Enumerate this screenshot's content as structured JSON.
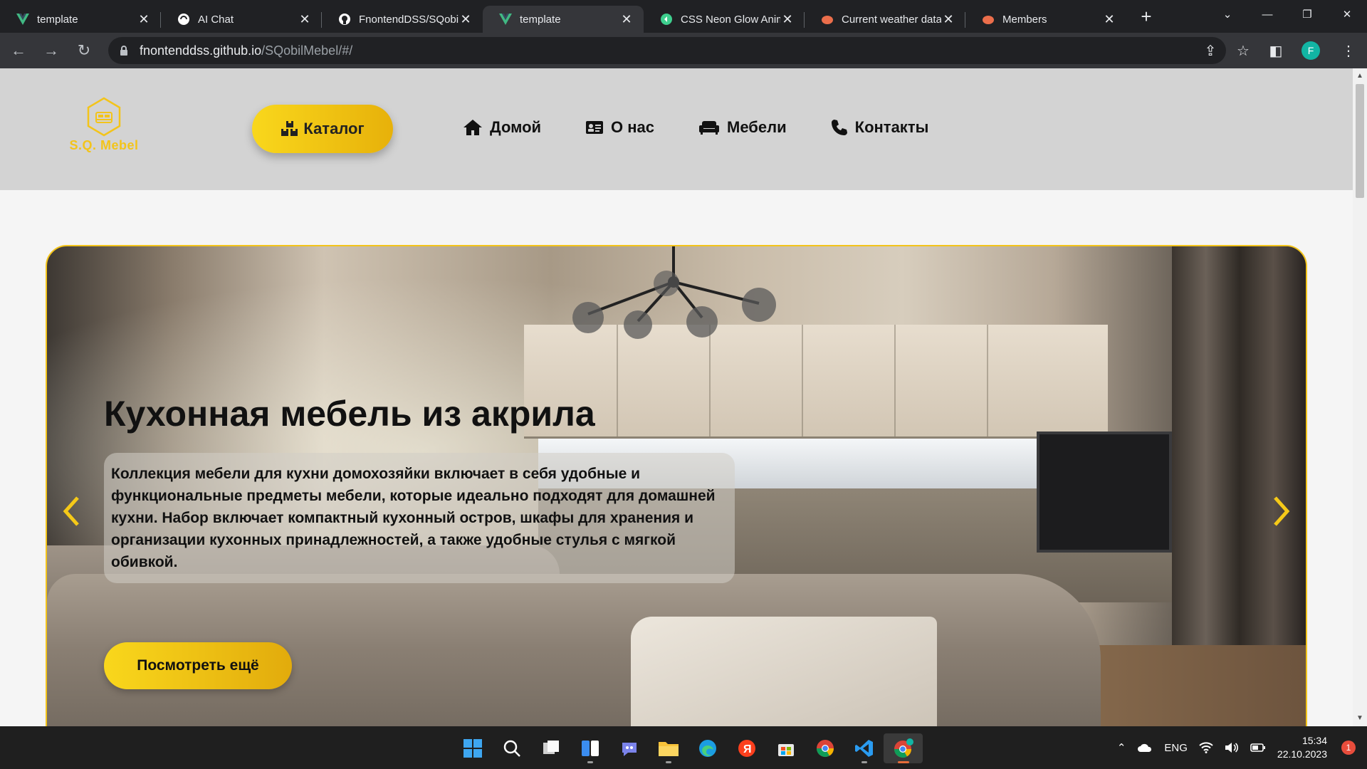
{
  "browser": {
    "tabs": [
      {
        "title": "template",
        "icon": "vue-icon",
        "active": false
      },
      {
        "title": "AI Chat",
        "icon": "chat-icon",
        "active": false
      },
      {
        "title": "FnontendDSS/SQobil",
        "icon": "github-icon",
        "active": false
      },
      {
        "title": "template",
        "icon": "vue-icon",
        "active": true
      },
      {
        "title": "CSS Neon Glow Anim",
        "icon": "codepen-icon",
        "active": false
      },
      {
        "title": "Current weather data",
        "icon": "weather-icon",
        "active": false
      },
      {
        "title": "Members",
        "icon": "weather-icon",
        "active": false
      }
    ],
    "new_tab": "+",
    "url_host": "fnontenddss.github.io",
    "url_path": "/SQobilMebel/#/",
    "profile_initial": "F"
  },
  "site": {
    "brand": "S.Q. Mebel",
    "catalog_label": "Каталог",
    "nav": [
      {
        "label": "Домой",
        "icon": "home-icon"
      },
      {
        "label": "О нас",
        "icon": "id-card-icon"
      },
      {
        "label": "Мебели",
        "icon": "couch-icon"
      },
      {
        "label": "Контакты",
        "icon": "phone-icon"
      }
    ],
    "accent": "#f3c41a",
    "header_bg": "#d3d3d3"
  },
  "hero": {
    "title": "Кухонная мебель из акрила",
    "description": "Коллекция мебели для кухни домохозяйки включает в себя удобные и функциональные предметы мебели, которые идеально подходят для домашней кухни. Набор включает компактный кухонный остров, шкафы для хранения и организации кухонных принадлежностей, а также удобные стулья с мягкой обивкой.",
    "button_label": "Посмотреть ещё"
  },
  "taskbar": {
    "apps": [
      "windows-start-icon",
      "search-icon",
      "task-view-icon",
      "widgets-icon",
      "teams-chat-icon",
      "file-explorer-icon",
      "edge-icon",
      "yandex-icon",
      "store-icon",
      "chrome-icon",
      "vscode-icon",
      "chrome-profile-icon"
    ],
    "language": "ENG",
    "time": "15:34",
    "date": "22.10.2023",
    "notifications": "1"
  }
}
